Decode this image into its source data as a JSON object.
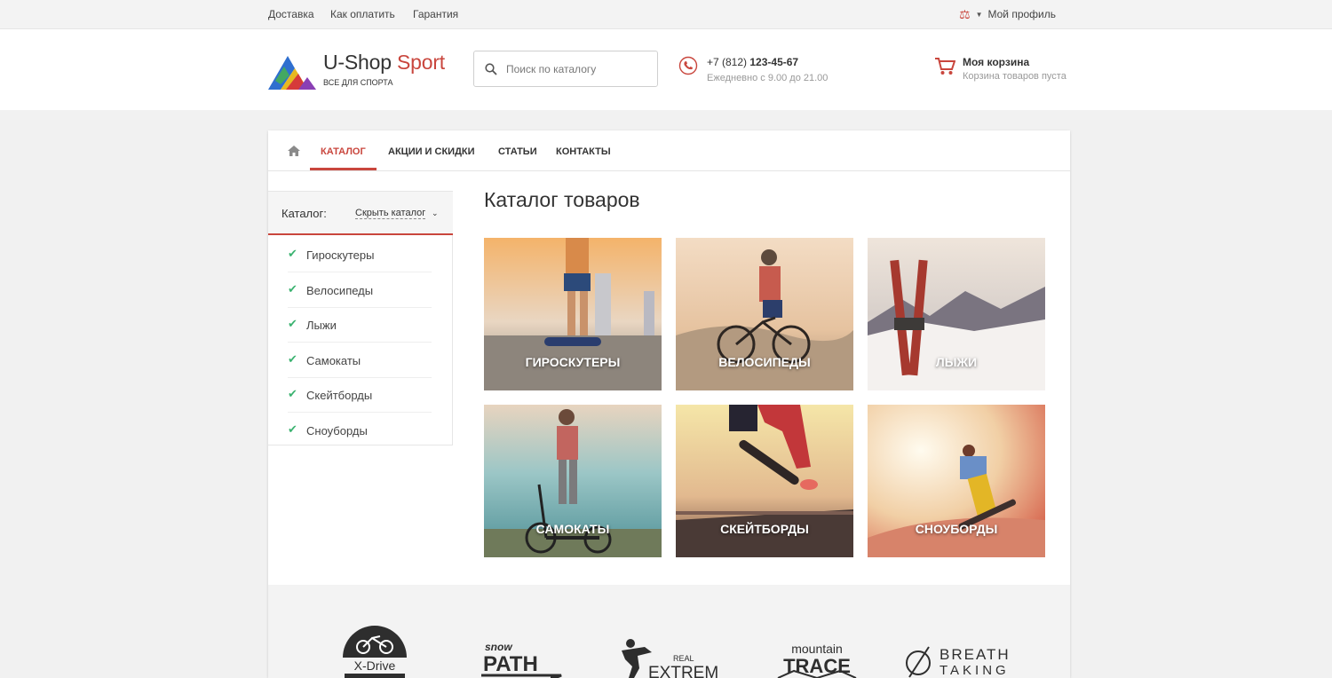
{
  "topbar": {
    "links": [
      "Доставка",
      "Как оплатить",
      "Гарантия"
    ],
    "profile_label": "Мой профиль",
    "compare_icon": "scales-icon"
  },
  "header": {
    "logo_title_main": "U-Shop",
    "logo_title_accent": "Sport",
    "logo_subtitle": "ВСЕ ДЛЯ СПОРТА",
    "search_placeholder": "Поиск по каталогу",
    "phone_prefix": "+7 (812)",
    "phone_number": "123-45-67",
    "phone_hours": "Ежедневно с 9.00 до 21.00",
    "cart_title": "Моя корзина",
    "cart_status": "Корзина товаров пуста",
    "accent_color": "#c9463d"
  },
  "nav": {
    "items": [
      "КАТАЛОГ",
      "АКЦИИ И СКИДКИ",
      "СТАТЬИ",
      "КОНТАКТЫ"
    ],
    "active_index": 0
  },
  "sidebar": {
    "label": "Каталог:",
    "toggle_label": "Скрыть каталог",
    "items": [
      "Гироскутеры",
      "Велосипеды",
      "Лыжи",
      "Самокаты",
      "Скейтборды",
      "Сноуборды"
    ]
  },
  "main": {
    "title": "Каталог товаров",
    "tiles": [
      "ГИРОСКУТЕРЫ",
      "ВЕЛОСИПЕДЫ",
      "ЛЫЖИ",
      "САМОКАТЫ",
      "СКЕЙТБОРДЫ",
      "СНОУБОРДЫ"
    ]
  },
  "brands": {
    "xdrive": "X-Drive",
    "snow_path_top": "snow",
    "snow_path_bottom": "PATH",
    "extreme_top": "REAL",
    "extreme_bottom": "EXTREME",
    "mountain_top": "mountain",
    "mountain_bottom": "TRACE",
    "breath_top": "BREATH",
    "breath_bottom": "TAKING"
  }
}
